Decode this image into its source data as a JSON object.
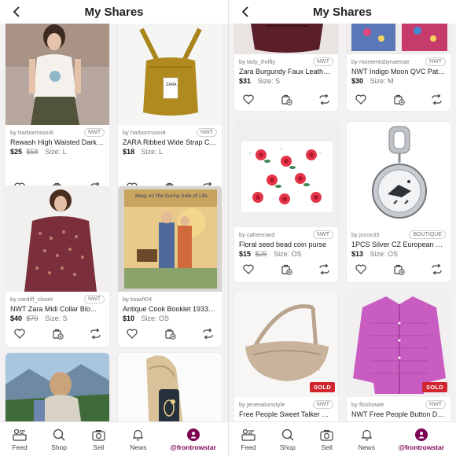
{
  "header": {
    "title": "My Shares"
  },
  "left_cards": [
    {
      "seller": "by harbormoon8",
      "badge": "NWT",
      "title": "Rewash High Waisted Dark G...",
      "price": "$25",
      "orig": "$58",
      "size": "Size: L"
    },
    {
      "seller": "by harbormoon8",
      "badge": "NWT",
      "title": "ZARA Ribbed Wide Strap Cr...",
      "price": "$18",
      "orig": "",
      "size": "Size: L"
    },
    {
      "seller": "by cardiff_closet",
      "badge": "NWT",
      "title": "NWT Zara Midi Collar Blo...",
      "price": "$40",
      "orig": "$70",
      "size": "Size: S"
    },
    {
      "seller": "by kswift04",
      "badge": "",
      "title": "Antique Cook Booklet 1933 K...",
      "price": "$10",
      "orig": "",
      "size": "Size: OS"
    }
  ],
  "right_cards": [
    {
      "seller": "by lady_thrifty",
      "badge": "NWT",
      "title": "Zara Burgundy Faux Leather...",
      "price": "$31",
      "orig": "",
      "size": "Size: S"
    },
    {
      "seller": "by momentsbynaenae",
      "badge": "NWT",
      "title": "NWT Indigo Moon QVC Patc...",
      "price": "$30",
      "orig": "",
      "size": "Size: M"
    },
    {
      "seller": "by cahennard",
      "badge": "NWT",
      "title": "Floral seed bead coin purse",
      "price": "$15",
      "orig": "$25",
      "size": "Size: OS"
    },
    {
      "seller": "by jccox33",
      "badge": "BOUTIQUE",
      "title": "1PCS Silver CZ European Ch...",
      "price": "$13",
      "orig": "",
      "size": "Size: OS"
    },
    {
      "seller": "by jenerationstyle",
      "badge": "NWT",
      "title": "Free People Sweet Talker Slin...",
      "price": "",
      "orig": "",
      "size": "",
      "sold": "SOLD"
    },
    {
      "seller": "by floshowie",
      "badge": "NWT",
      "title": "NWT Free People Button Do...",
      "price": "",
      "orig": "",
      "size": "",
      "sold": "SOLD"
    }
  ],
  "tabs": {
    "feed": "Feed",
    "shop": "Shop",
    "sell": "Sell",
    "news": "News",
    "profile": "@frontrowstar"
  },
  "colors": {
    "accent": "#7f0353",
    "sold_badge": "#d1262e",
    "background": "#f3f1f2"
  }
}
